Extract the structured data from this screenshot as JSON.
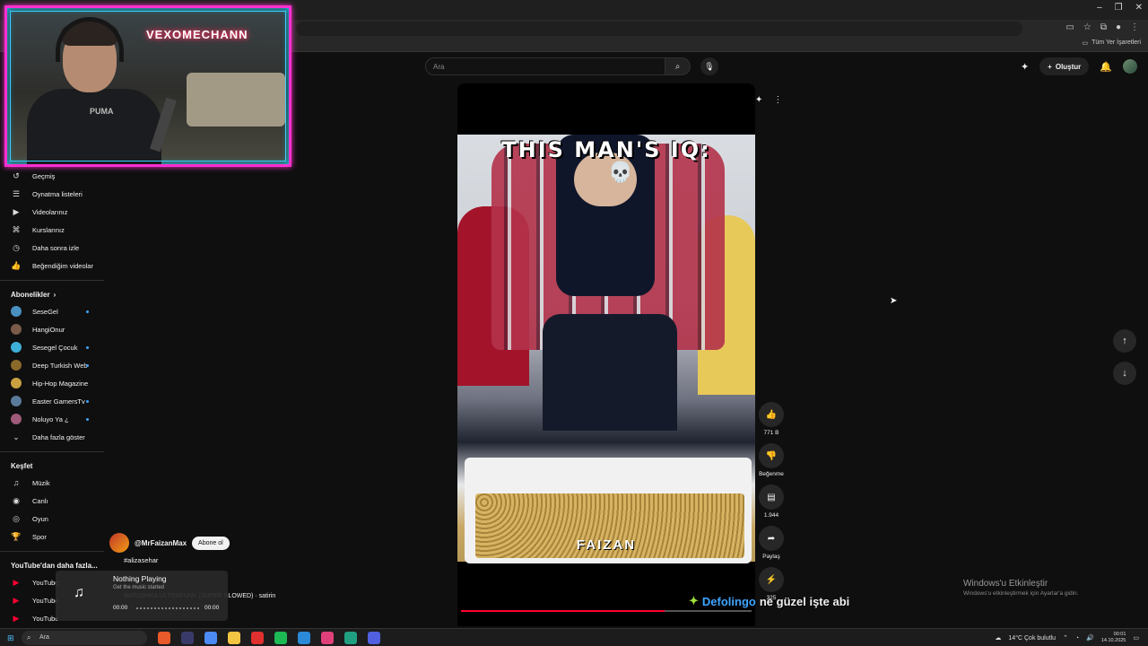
{
  "browser": {
    "window_controls": [
      "–",
      "❐",
      "✕"
    ],
    "bookmarks_all": "Tüm Yer İşaretleri"
  },
  "search": {
    "placeholder": "Ara"
  },
  "header": {
    "create_label": "Oluştur"
  },
  "webcam": {
    "neon_text": "VEXOMECHANN",
    "shirt_text": "PUMA"
  },
  "sidebar": {
    "you_items": [
      {
        "icon": "history-icon",
        "glyph": "↺",
        "label": "Geçmiş"
      },
      {
        "icon": "playlist-icon",
        "glyph": "☰",
        "label": "Oynatma listeleri"
      },
      {
        "icon": "your-videos-icon",
        "glyph": "▶",
        "label": "Videolarınız"
      },
      {
        "icon": "courses-icon",
        "glyph": "⌘",
        "label": "Kurslarınız"
      },
      {
        "icon": "watch-later-icon",
        "glyph": "◷",
        "label": "Daha sonra izle"
      },
      {
        "icon": "liked-icon",
        "glyph": "👍",
        "label": "Beğendiğim videolar"
      }
    ],
    "subs_title": "Abonelikler",
    "subscriptions": [
      {
        "label": "SeseGel",
        "color": "#4a90c0",
        "dot": true
      },
      {
        "label": "HangiOnur",
        "color": "#7a5a48",
        "dot": false
      },
      {
        "label": "Sesegel Çocuk",
        "color": "#3eb0d8",
        "dot": true
      },
      {
        "label": "Deep Turkish Web",
        "color": "#8a6a2a",
        "dot": true
      },
      {
        "label": "Hip-Hop Magazine",
        "color": "#c8a040",
        "dot": false
      },
      {
        "label": "Easter GamersTv",
        "color": "#5a7a9a",
        "dot": true
      },
      {
        "label": "Noluyo Ya ¿",
        "color": "#a05a7a",
        "dot": true
      }
    ],
    "show_more": "Daha fazla göster",
    "explore_title": "Keşfet",
    "explore_items": [
      {
        "icon": "music-icon",
        "glyph": "♫",
        "label": "Müzik"
      },
      {
        "icon": "live-icon",
        "glyph": "◉",
        "label": "Canlı"
      },
      {
        "icon": "gaming-icon",
        "glyph": "◎",
        "label": "Oyun"
      },
      {
        "icon": "sports-icon",
        "glyph": "🏆",
        "label": "Spor"
      }
    ],
    "more_title": "YouTube'dan daha fazla...",
    "more_items": [
      "YouTube",
      "YouTube",
      "YouTube"
    ]
  },
  "video": {
    "title_overlay": "THIS MAN'S IQ:",
    "watermark": "FAIZAN",
    "progress": 0.7
  },
  "actions": {
    "like_count": "771 B",
    "dislike_label": "Beğenme",
    "comments_count": "1.944",
    "share_label": "Paylaş",
    "remix_count": "325"
  },
  "channel": {
    "name": "@MrFaizanMax",
    "subscribe": "Abone ol",
    "hashtag": "#alizasehar",
    "song": "MATUSHKA ULTRAFUNK (SUPER SLOWED) · satirin"
  },
  "music_widget": {
    "title": "Nothing Playing",
    "subtitle": "Get the music started",
    "time_start": "00:00",
    "time_end": "00:00"
  },
  "caption": {
    "name": "Defolingo",
    "text": "ne güzel işte abi"
  },
  "activation": {
    "title": "Windows'u Etkinleştir",
    "subtitle": "Windows'u etkinleştirmek için Ayarlar'a gidin."
  },
  "taskbar": {
    "search": "Ara",
    "weather": "14°C  Çok bulutlu",
    "time": "00:01",
    "date": "14.10.2025",
    "apps": [
      "#e85a2a",
      "#3a3a6a",
      "#4c8bf5",
      "#f4c542",
      "#e03030",
      "#1db954",
      "#2a8ad8",
      "#e0407a",
      "#20a080",
      "#5060e0"
    ]
  }
}
